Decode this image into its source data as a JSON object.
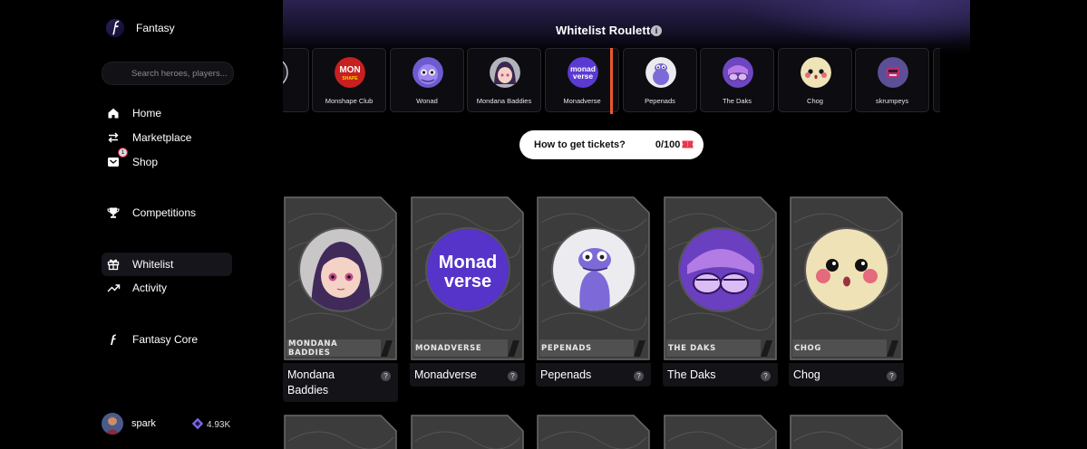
{
  "app": {
    "name": "Fantasy"
  },
  "search": {
    "placeholder": "Search heroes, players..."
  },
  "nav": {
    "home": "Home",
    "marketplace": "Marketplace",
    "shop": "Shop",
    "shop_badge": "1",
    "competitions": "Competitions",
    "whitelist": "Whitelist",
    "activity": "Activity",
    "fantasy_core": "Fantasy Core"
  },
  "user": {
    "name": "spark",
    "points": "4.93K"
  },
  "header": {
    "title": "Whitelist Roulette",
    "info": "i"
  },
  "roulette": {
    "items": [
      {
        "name": "",
        "icon": "partial-logo-icon"
      },
      {
        "name": "Monshape Club",
        "icon": "monshape-club-logo"
      },
      {
        "name": "Wonad",
        "icon": "wonad-logo"
      },
      {
        "name": "Mondana Baddies",
        "icon": "mondana-baddies-logo"
      },
      {
        "name": "Monadverse",
        "icon": "monadverse-logo",
        "selected": true
      },
      {
        "name": "Pepenads",
        "icon": "pepenads-logo"
      },
      {
        "name": "The Daks",
        "icon": "the-daks-logo"
      },
      {
        "name": "Chog",
        "icon": "chog-logo"
      },
      {
        "name": "skrumpeys",
        "icon": "skrumpeys-logo"
      }
    ],
    "logo_text": {
      "monshape": "MON",
      "monshape_sub": "SHAPE",
      "monadverse_1": "monad",
      "monadverse_2": "verse"
    }
  },
  "tickets": {
    "label": "How to get tickets?",
    "count": "0/100"
  },
  "cards": [
    {
      "name": "Mondana Baddies",
      "plate": "MONDANA BADDIES",
      "help": "?"
    },
    {
      "name": "Monadverse",
      "plate": "MONADVERSE",
      "help": "?"
    },
    {
      "name": "Pepenads",
      "plate": "PEPENADS",
      "help": "?"
    },
    {
      "name": "The Daks",
      "plate": "THE DAKS",
      "help": "?"
    },
    {
      "name": "Chog",
      "plate": "CHOG",
      "help": "?"
    }
  ],
  "card_art_text": {
    "monadverse_1": "Monad",
    "monadverse_2": "verse"
  },
  "colors": {
    "accent_marker": "#e8582b",
    "monad_purple": "#5b3ad1",
    "tile_bg": "#0d0d11"
  }
}
